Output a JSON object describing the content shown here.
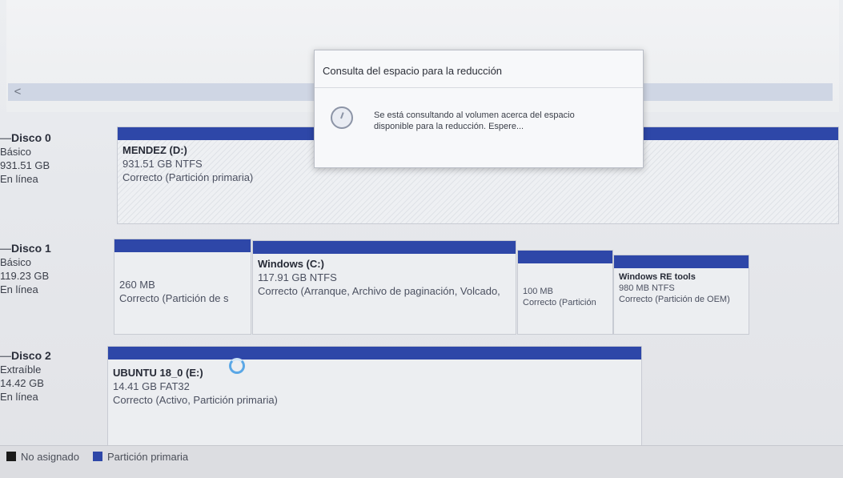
{
  "disks": [
    {
      "name": "Disco 0",
      "type": "Básico",
      "size": "931.51 GB",
      "status": "En línea",
      "partitions": [
        {
          "name": "MENDEZ  (D:)",
          "size_fs": "931.51 GB NTFS",
          "state": "Correcto (Partición primaria)"
        }
      ]
    },
    {
      "name": "Disco 1",
      "type": "Básico",
      "size": "119.23 GB",
      "status": "En línea",
      "partitions": [
        {
          "name": "",
          "size_fs": "260 MB",
          "state": "Correcto (Partición de s"
        },
        {
          "name": "Windows  (C:)",
          "size_fs": "117.91 GB NTFS",
          "state": "Correcto (Arranque, Archivo de paginación, Volcado,"
        },
        {
          "name": "",
          "size_fs": "100 MB",
          "state": "Correcto (Partición"
        },
        {
          "name": "Windows RE tools",
          "size_fs": "980 MB NTFS",
          "state": "Correcto (Partición de OEM)"
        }
      ]
    },
    {
      "name": "Disco 2",
      "type": "Extraíble",
      "size": "14.42 GB",
      "status": "En línea",
      "partitions": [
        {
          "name": "UBUNTU 18_0  (E:)",
          "size_fs": "14.41 GB FAT32",
          "state": "Correcto (Activo, Partición primaria)"
        }
      ]
    }
  ],
  "dialog": {
    "title": "Consulta del espacio para la reducción",
    "message": "Se está consultando al volumen acerca del espacio disponible para la reducción.  Espere..."
  },
  "legend": {
    "unallocated": "No asignado",
    "primary": "Partición primaria"
  },
  "colors": {
    "primary_partition": "#2e47a8",
    "unallocated": "#1a1a1a"
  },
  "icons": {
    "scroll_left": "<",
    "clock": "clock-icon"
  }
}
